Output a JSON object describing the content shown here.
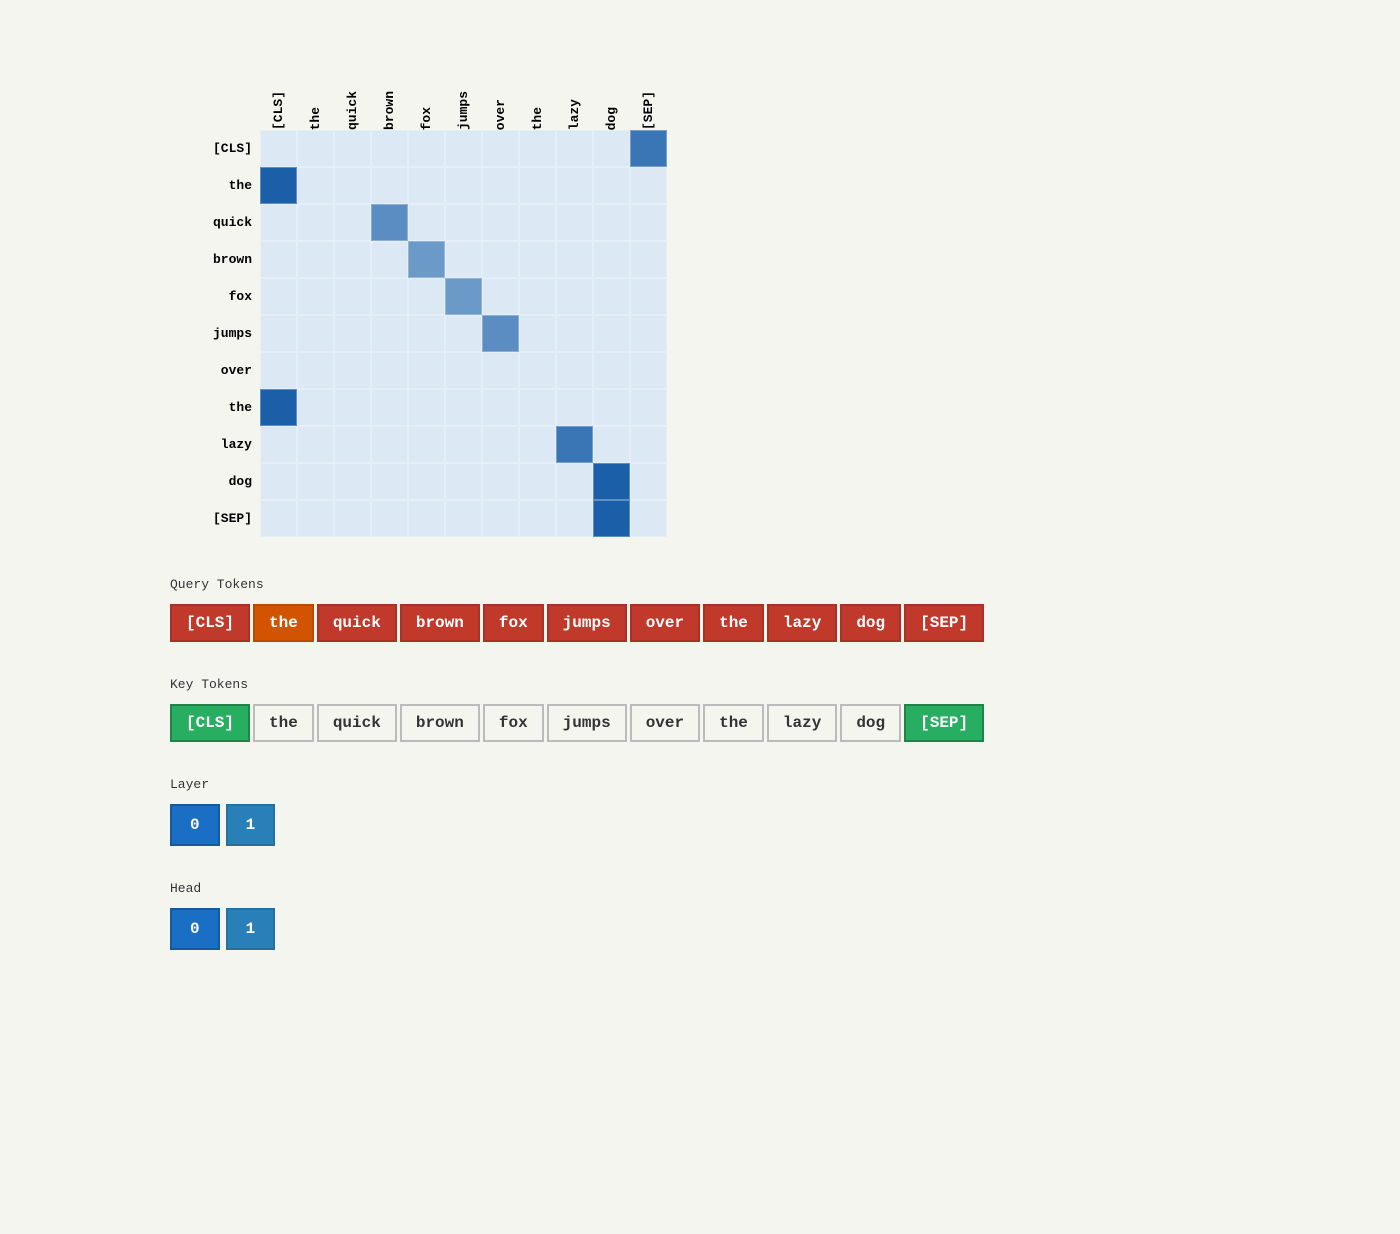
{
  "tokens": [
    "[CLS]",
    "the",
    "quick",
    "brown",
    "fox",
    "jumps",
    "over",
    "the",
    "lazy",
    "dog",
    "[SEP]"
  ],
  "query_label": "Query Tokens",
  "key_label": "Key Tokens",
  "layer_label": "Layer",
  "head_label": "Head",
  "layer_buttons": [
    "0",
    "1"
  ],
  "head_buttons": [
    "0",
    "1"
  ],
  "active_layer": 0,
  "active_head": 0,
  "matrix": {
    "rows": 11,
    "cols": 11,
    "values": [
      [
        0.05,
        0.05,
        0.05,
        0.05,
        0.05,
        0.05,
        0.05,
        0.05,
        0.05,
        0.05,
        0.55
      ],
      [
        0.65,
        0.05,
        0.05,
        0.05,
        0.05,
        0.05,
        0.05,
        0.05,
        0.05,
        0.05,
        0.05
      ],
      [
        0.05,
        0.05,
        0.05,
        0.45,
        0.05,
        0.05,
        0.05,
        0.05,
        0.05,
        0.05,
        0.05
      ],
      [
        0.05,
        0.05,
        0.05,
        0.05,
        0.4,
        0.05,
        0.05,
        0.05,
        0.05,
        0.05,
        0.05
      ],
      [
        0.05,
        0.05,
        0.05,
        0.05,
        0.05,
        0.4,
        0.05,
        0.05,
        0.05,
        0.05,
        0.05
      ],
      [
        0.05,
        0.05,
        0.05,
        0.05,
        0.05,
        0.05,
        0.45,
        0.05,
        0.05,
        0.05,
        0.05
      ],
      [
        0.05,
        0.05,
        0.05,
        0.05,
        0.05,
        0.05,
        0.05,
        0.05,
        0.05,
        0.05,
        0.05
      ],
      [
        0.65,
        0.05,
        0.05,
        0.05,
        0.05,
        0.05,
        0.05,
        0.05,
        0.05,
        0.05,
        0.05
      ],
      [
        0.05,
        0.05,
        0.05,
        0.05,
        0.05,
        0.05,
        0.05,
        0.05,
        0.55,
        0.05,
        0.05
      ],
      [
        0.05,
        0.05,
        0.05,
        0.05,
        0.05,
        0.05,
        0.05,
        0.05,
        0.05,
        0.65,
        0.05
      ],
      [
        0.05,
        0.05,
        0.05,
        0.05,
        0.05,
        0.05,
        0.05,
        0.05,
        0.05,
        0.65,
        0.05
      ]
    ]
  }
}
